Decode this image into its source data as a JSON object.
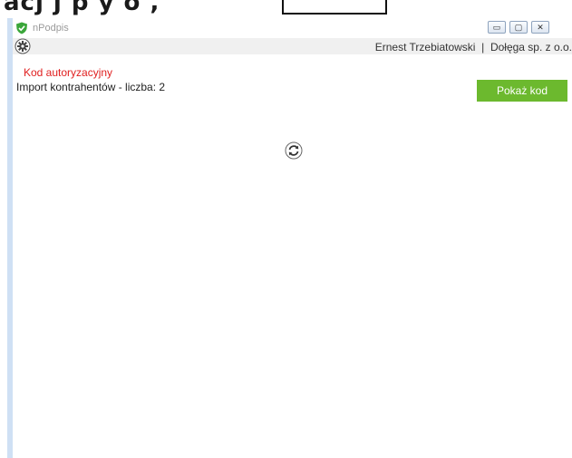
{
  "background_doc": {
    "partial_text": "acj        j p   y  o     ,",
    "boxed_text": ""
  },
  "window": {
    "app_title": "nPodpis",
    "controls": {
      "minimize": "▭",
      "maximize": "▢",
      "close": "✕"
    }
  },
  "toolbar": {
    "user_name": "Ernest Trzebiatowski",
    "separator": "|",
    "company": "Dołęga sp. z o.o."
  },
  "main": {
    "auth_title": "Kod autoryzacyjny",
    "import_label": "Import kontrahentów - liczba: 2",
    "show_code_label": "Pokaż kod"
  },
  "icons": {
    "app": "shield-icon",
    "settings": "gear-icon",
    "refresh": "refresh-icon"
  },
  "colors": {
    "accent_green": "#6cb92e",
    "auth_red": "#e02020",
    "window_border": "#cfe0f4"
  }
}
